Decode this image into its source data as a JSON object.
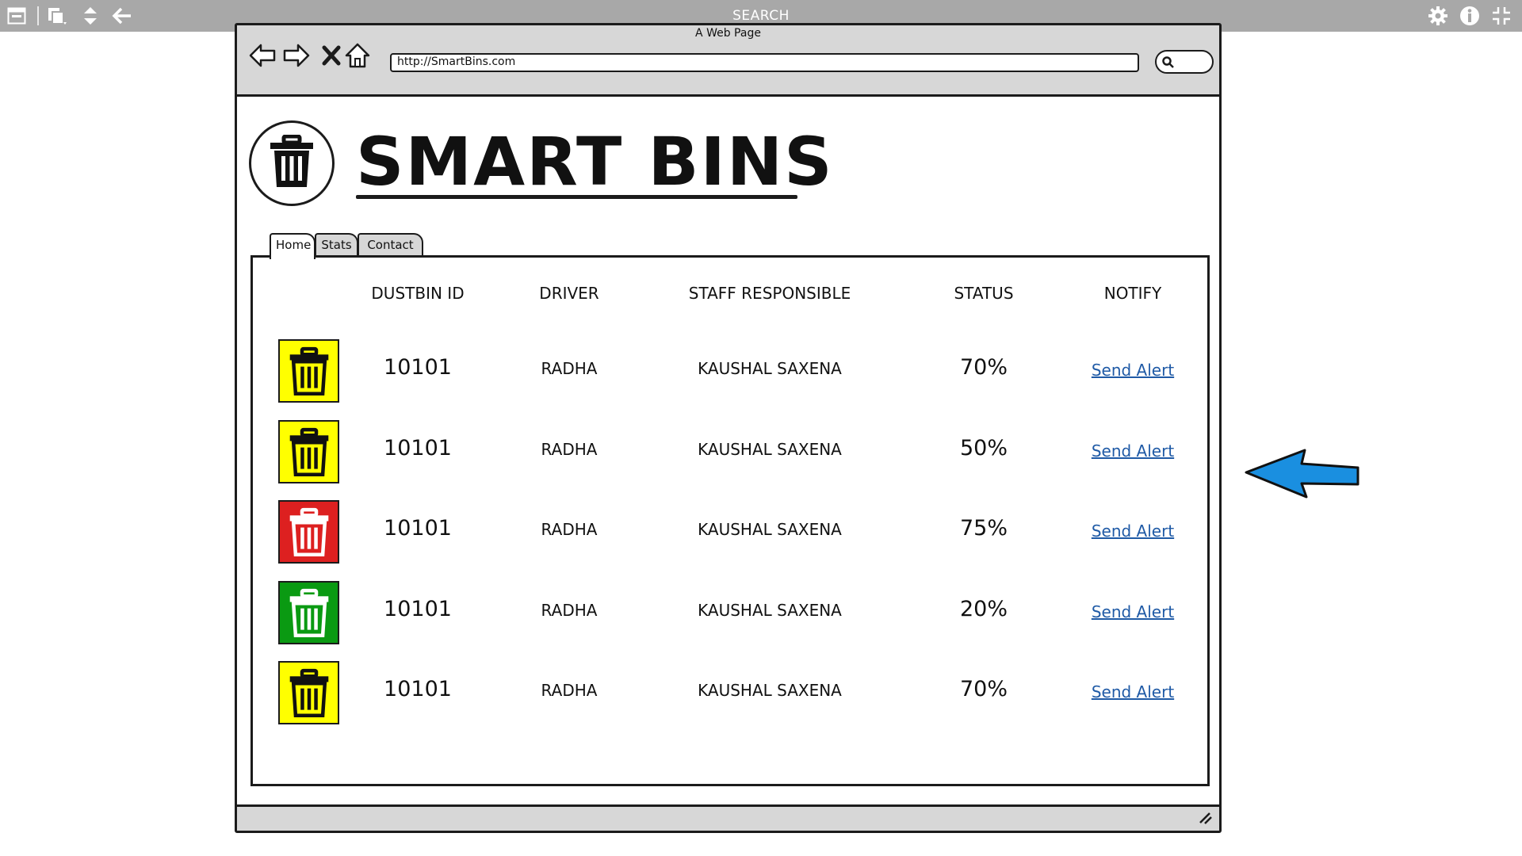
{
  "toolbar": {
    "title": "SEARCH",
    "icons": [
      "window-icon",
      "copy-icon",
      "expand-collapse-icon",
      "back-arrow-icon",
      "gear-icon",
      "info-icon",
      "fullscreen-exit-icon"
    ]
  },
  "browser": {
    "page_title": "A Web Page",
    "url": "http://SmartBins.com",
    "nav_icons": [
      "back-icon",
      "forward-icon",
      "stop-icon",
      "home-icon"
    ]
  },
  "page": {
    "brand": "SMART BINS",
    "tabs": [
      {
        "label": "Home",
        "active": true
      },
      {
        "label": "Stats",
        "active": false
      },
      {
        "label": "Contact",
        "active": false
      }
    ],
    "table": {
      "headers": [
        "DUSTBIN ID",
        "DRIVER",
        "STAFF RESPONSIBLE",
        "STATUS",
        "NOTIFY"
      ],
      "rows": [
        {
          "bin_color": "#ffff00",
          "icon_color": "#111111",
          "id": "10101",
          "driver": "RADHA",
          "staff": "KAUSHAL SAXENA",
          "status": "70%",
          "action": "Send Alert"
        },
        {
          "bin_color": "#ffff00",
          "icon_color": "#111111",
          "id": "10101",
          "driver": "RADHA",
          "staff": "KAUSHAL SAXENA",
          "status": "50%",
          "action": "Send Alert"
        },
        {
          "bin_color": "#dd2020",
          "icon_color": "#ffffff",
          "id": "10101",
          "driver": "RADHA",
          "staff": "KAUSHAL SAXENA",
          "status": "75%",
          "action": "Send Alert"
        },
        {
          "bin_color": "#0a9a12",
          "icon_color": "#ffffff",
          "id": "10101",
          "driver": "RADHA",
          "staff": "KAUSHAL SAXENA",
          "status": "20%",
          "action": "Send Alert"
        },
        {
          "bin_color": "#ffff00",
          "icon_color": "#111111",
          "id": "10101",
          "driver": "RADHA",
          "staff": "KAUSHAL SAXENA",
          "status": "70%",
          "action": "Send Alert"
        }
      ]
    }
  },
  "colors": {
    "toolbar_bg": "#a8a8a8",
    "chrome_bg": "#d7d7d7",
    "link": "#1f5aa6",
    "arrow": "#1a8fe0"
  }
}
